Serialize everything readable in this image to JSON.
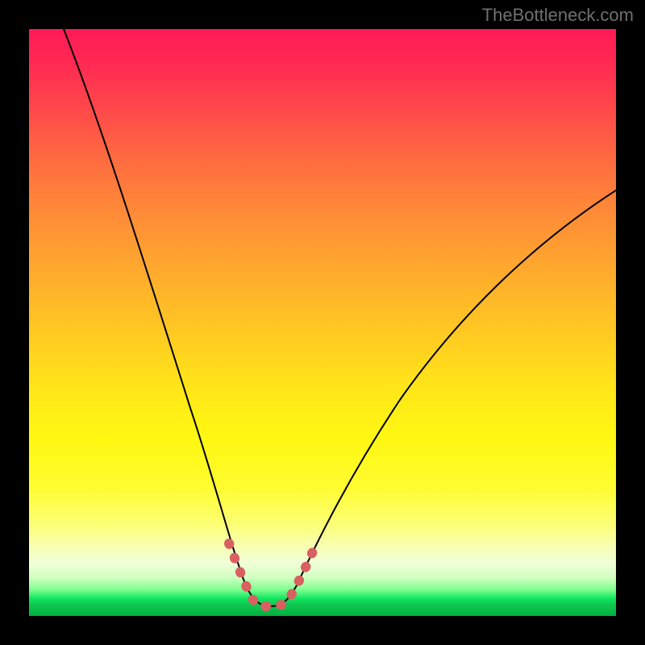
{
  "watermark": "TheBottleneck.com",
  "chart_data": {
    "type": "line",
    "title": "",
    "xlabel": "",
    "ylabel": "",
    "xlim": [
      0,
      100
    ],
    "ylim": [
      0,
      100
    ],
    "series": [
      {
        "name": "bottleneck-curve",
        "x": [
          6,
          10,
          14,
          18,
          22,
          26,
          30,
          33,
          35.5,
          38,
          40,
          42,
          44,
          47,
          52,
          58,
          64,
          70,
          76,
          82,
          88,
          94,
          100
        ],
        "y": [
          100,
          88,
          76,
          64,
          52,
          40,
          28,
          18,
          10,
          5,
          3.2,
          3.2,
          5,
          11,
          20,
          28,
          35,
          41,
          47,
          52,
          57,
          62,
          67
        ]
      }
    ],
    "annotations": [
      {
        "name": "optimal-range-marker",
        "x_range": [
          34,
          46
        ],
        "y_range": [
          3,
          14
        ],
        "style": "dotted-pink"
      }
    ],
    "background": "rainbow-gradient-red-to-green",
    "grid": false
  }
}
